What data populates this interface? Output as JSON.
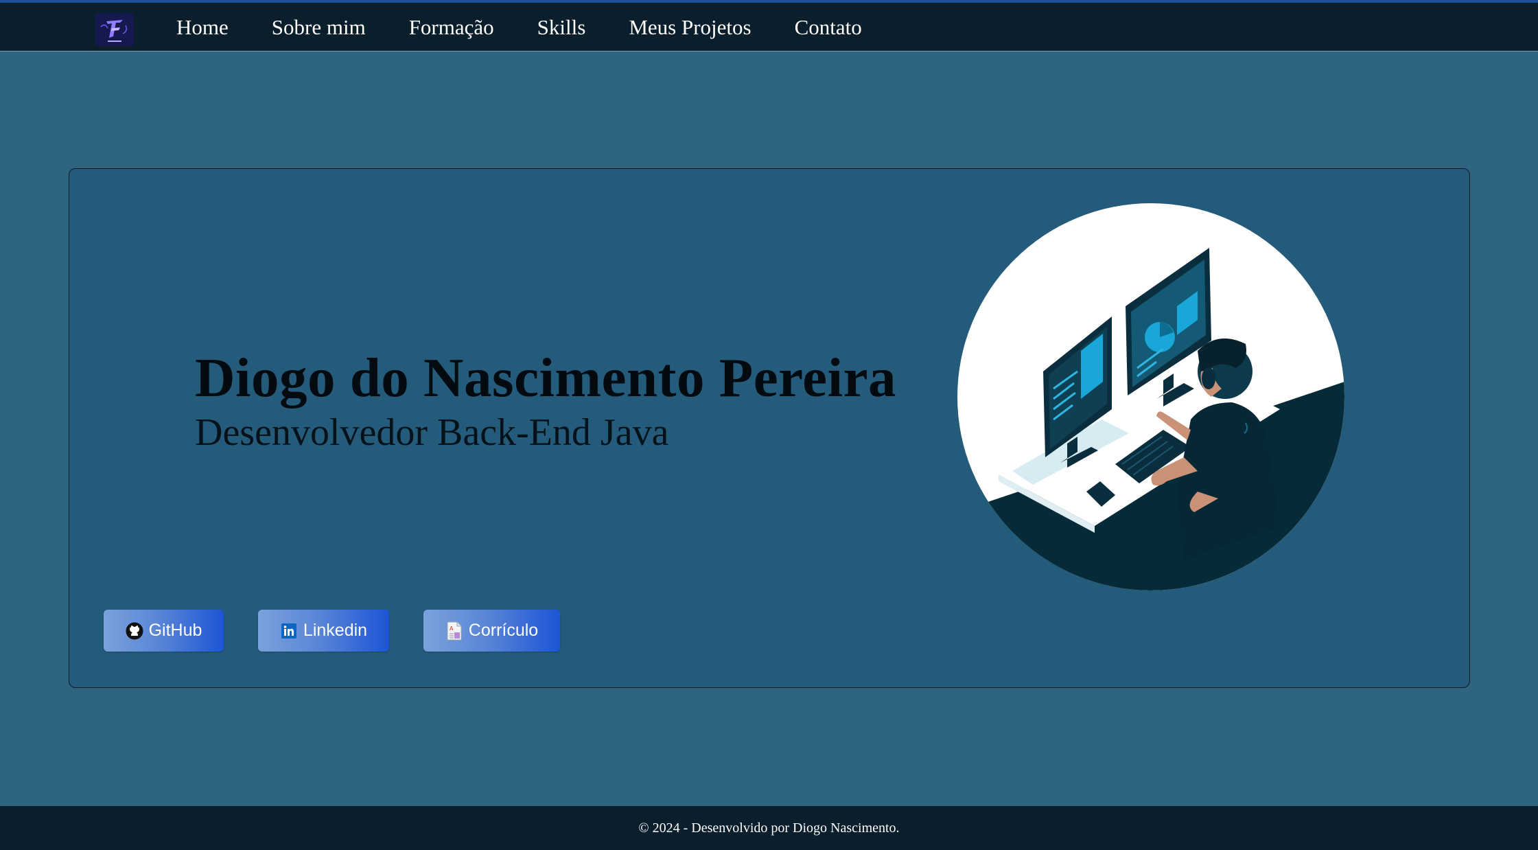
{
  "nav": {
    "logo_icon": "brand-logo-icon",
    "links": [
      {
        "label": "Home"
      },
      {
        "label": "Sobre mim"
      },
      {
        "label": "Formação"
      },
      {
        "label": "Skills"
      },
      {
        "label": "Meus Projetos"
      },
      {
        "label": "Contato"
      }
    ]
  },
  "hero": {
    "name": "Diogo do Nascimento Pereira",
    "role": "Desenvolvedor Back-End Java",
    "illustration_icon": "developer-at-computer-illustration",
    "buttons": [
      {
        "label": "GitHub",
        "icon": "github-icon"
      },
      {
        "label": "Linkedin",
        "icon": "linkedin-icon"
      },
      {
        "label": "Corrículo",
        "icon": "document-icon"
      }
    ]
  },
  "footer": {
    "text": "© 2024 - Desenvolvido por Diogo Nascimento."
  },
  "colors": {
    "background": "#2f6480",
    "navbar": "#0a1e2b",
    "card": "#255b7a",
    "button_start": "#7aa2dc",
    "button_end": "#1c55d6",
    "illustration_dark": "#052a38",
    "illustration_accent": "#19a6d8"
  }
}
